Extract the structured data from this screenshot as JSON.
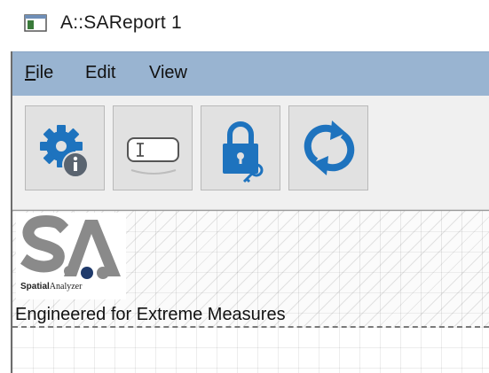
{
  "window": {
    "title": "A::SAReport 1"
  },
  "menu": {
    "items": [
      {
        "label": "File",
        "mnemonic": "F"
      },
      {
        "label": "Edit",
        "mnemonic": ""
      },
      {
        "label": "View",
        "mnemonic": ""
      }
    ]
  },
  "toolbar": {
    "buttons": [
      {
        "icon": "gear-info-icon"
      },
      {
        "icon": "text-field-icon"
      },
      {
        "icon": "lock-key-icon"
      },
      {
        "icon": "refresh-icon"
      }
    ]
  },
  "report": {
    "logo": {
      "mark": "S.A",
      "caption_bold": "Spatial",
      "caption_rest": "Analyzer"
    },
    "tagline": "Engineered for Extreme Measures"
  },
  "colors": {
    "menubar": "#99b4d1",
    "icon_blue": "#1e73be",
    "logo_gray": "#8a8a8a",
    "logo_navy": "#1f3a6b"
  }
}
